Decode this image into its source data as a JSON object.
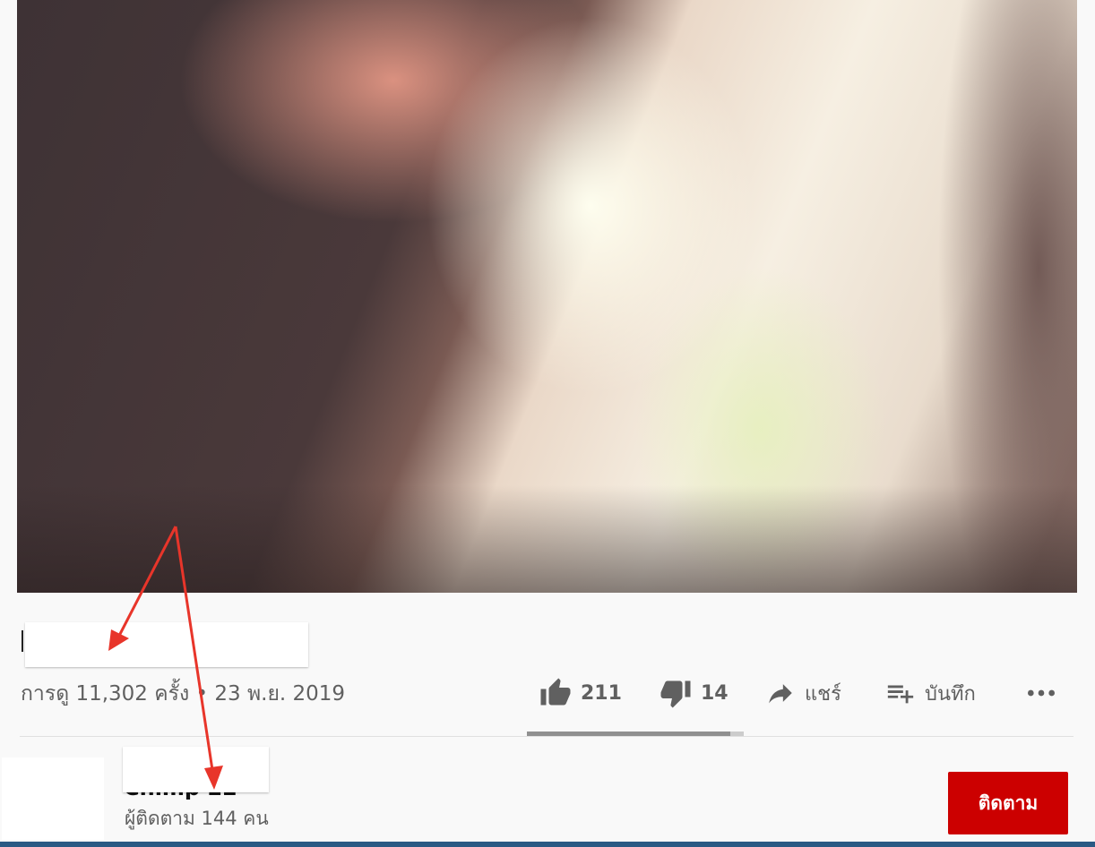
{
  "video": {
    "title_text": "",
    "meta": "การดู 11,302 ครั้ง • 23 พ.ย. 2019"
  },
  "actions": {
    "like_count": "211",
    "dislike_count": "14",
    "share_label": "แชร์",
    "save_label": "บันทึก",
    "like_ratio": 0.938
  },
  "channel": {
    "name": "Chimp 22",
    "subscribers": "ผู้ติดตาม 144 คน",
    "subscribe_label": "ติดตาม"
  },
  "colors": {
    "subscribe_bg": "#cc0000",
    "annotation_arrow": "#e8352a",
    "redaction_box": "#ffffff",
    "bottom_bar": "#2a5a84"
  },
  "icons": [
    "like-icon",
    "dislike-icon",
    "share-icon",
    "save-to-playlist-icon",
    "more-options-icon"
  ]
}
